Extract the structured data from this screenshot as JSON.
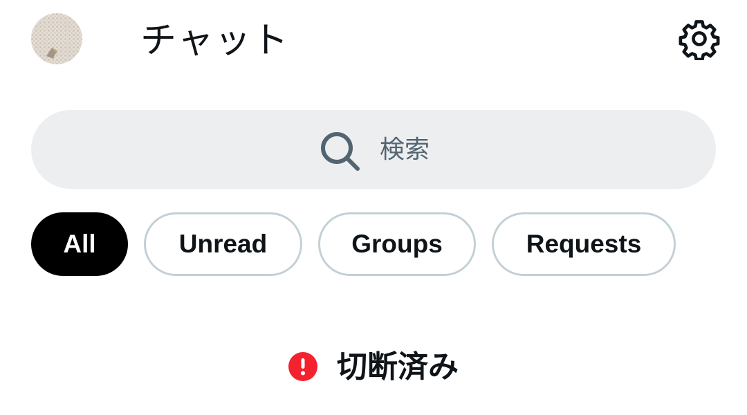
{
  "header": {
    "title": "チャット",
    "avatar_icon": "user-avatar",
    "settings_icon": "gear-icon"
  },
  "search": {
    "placeholder": "検索",
    "icon": "search-icon"
  },
  "filters": [
    {
      "label": "All",
      "active": true
    },
    {
      "label": "Unread",
      "active": false
    },
    {
      "label": "Groups",
      "active": false
    },
    {
      "label": "Requests",
      "active": false
    }
  ],
  "status": {
    "text": "切断済み",
    "icon": "alert-icon",
    "color": "#f4212e"
  }
}
